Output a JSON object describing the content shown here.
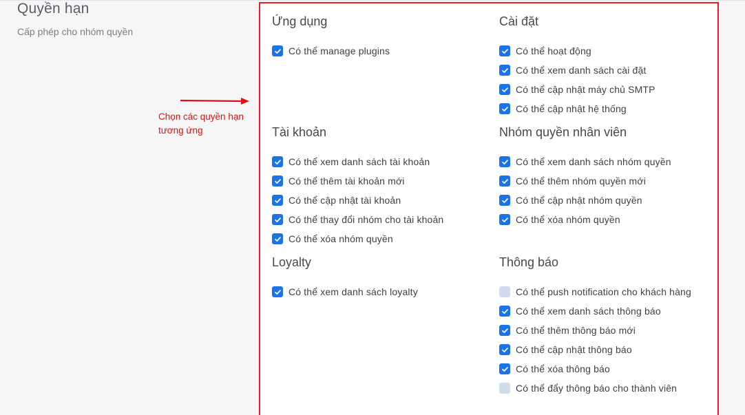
{
  "header": {
    "title": "Quyền hạn",
    "description": "Cấp phép cho nhóm quyền"
  },
  "annotation": {
    "text_line1": "Chọn các quyền hạn",
    "text_line2": "tương ứng",
    "color": "#e01010"
  },
  "colors": {
    "checkbox_checked": "#1a73e8",
    "checkbox_unchecked": "#cfdcec",
    "highlight_border": "#ec1c24"
  },
  "sections": {
    "ung_dung": {
      "title": "Ứng dụng",
      "permissions": [
        {
          "label": "Có thể manage plugins",
          "checked": true
        }
      ]
    },
    "cai_dat": {
      "title": "Cài đặt",
      "permissions": [
        {
          "label": "Có thể hoạt động",
          "checked": true
        },
        {
          "label": "Có thể xem danh sách cài đặt",
          "checked": true
        },
        {
          "label": "Có thể cập nhật máy chủ SMTP",
          "checked": true
        },
        {
          "label": "Có thể cập nhật hệ thống",
          "checked": true
        }
      ]
    },
    "tai_khoan": {
      "title": "Tài khoản",
      "permissions": [
        {
          "label": "Có thể xem danh sách tài khoản",
          "checked": true
        },
        {
          "label": "Có thể thêm tài khoản mới",
          "checked": true
        },
        {
          "label": "Có thể cập nhật tài khoản",
          "checked": true
        },
        {
          "label": "Có thể thay đổi nhóm cho tài khoản",
          "checked": true
        },
        {
          "label": "Có thể xóa nhóm quyền",
          "checked": true
        }
      ]
    },
    "nhom_quyen": {
      "title": "Nhóm quyền nhân viên",
      "permissions": [
        {
          "label": "Có thể xem danh sách nhóm quyền",
          "checked": true
        },
        {
          "label": "Có thể thêm nhóm quyền mới",
          "checked": true
        },
        {
          "label": "Có thể cập nhật nhóm quyền",
          "checked": true
        },
        {
          "label": "Có thể xóa nhóm quyền",
          "checked": true
        }
      ]
    },
    "loyalty": {
      "title": "Loyalty",
      "permissions": [
        {
          "label": "Có thể xem danh sách loyalty",
          "checked": true
        }
      ]
    },
    "thong_bao": {
      "title": "Thông báo",
      "permissions": [
        {
          "label": "Có thể push notification cho khách hàng",
          "checked": false
        },
        {
          "label": "Có thể xem danh sách thông báo",
          "checked": true
        },
        {
          "label": "Có thể thêm thông báo mới",
          "checked": true
        },
        {
          "label": "Có thể cập nhật thông báo",
          "checked": true
        },
        {
          "label": "Có thể xóa thông báo",
          "checked": true
        },
        {
          "label": "Có thể đẩy thông báo cho thành viên",
          "checked": false
        }
      ]
    }
  }
}
